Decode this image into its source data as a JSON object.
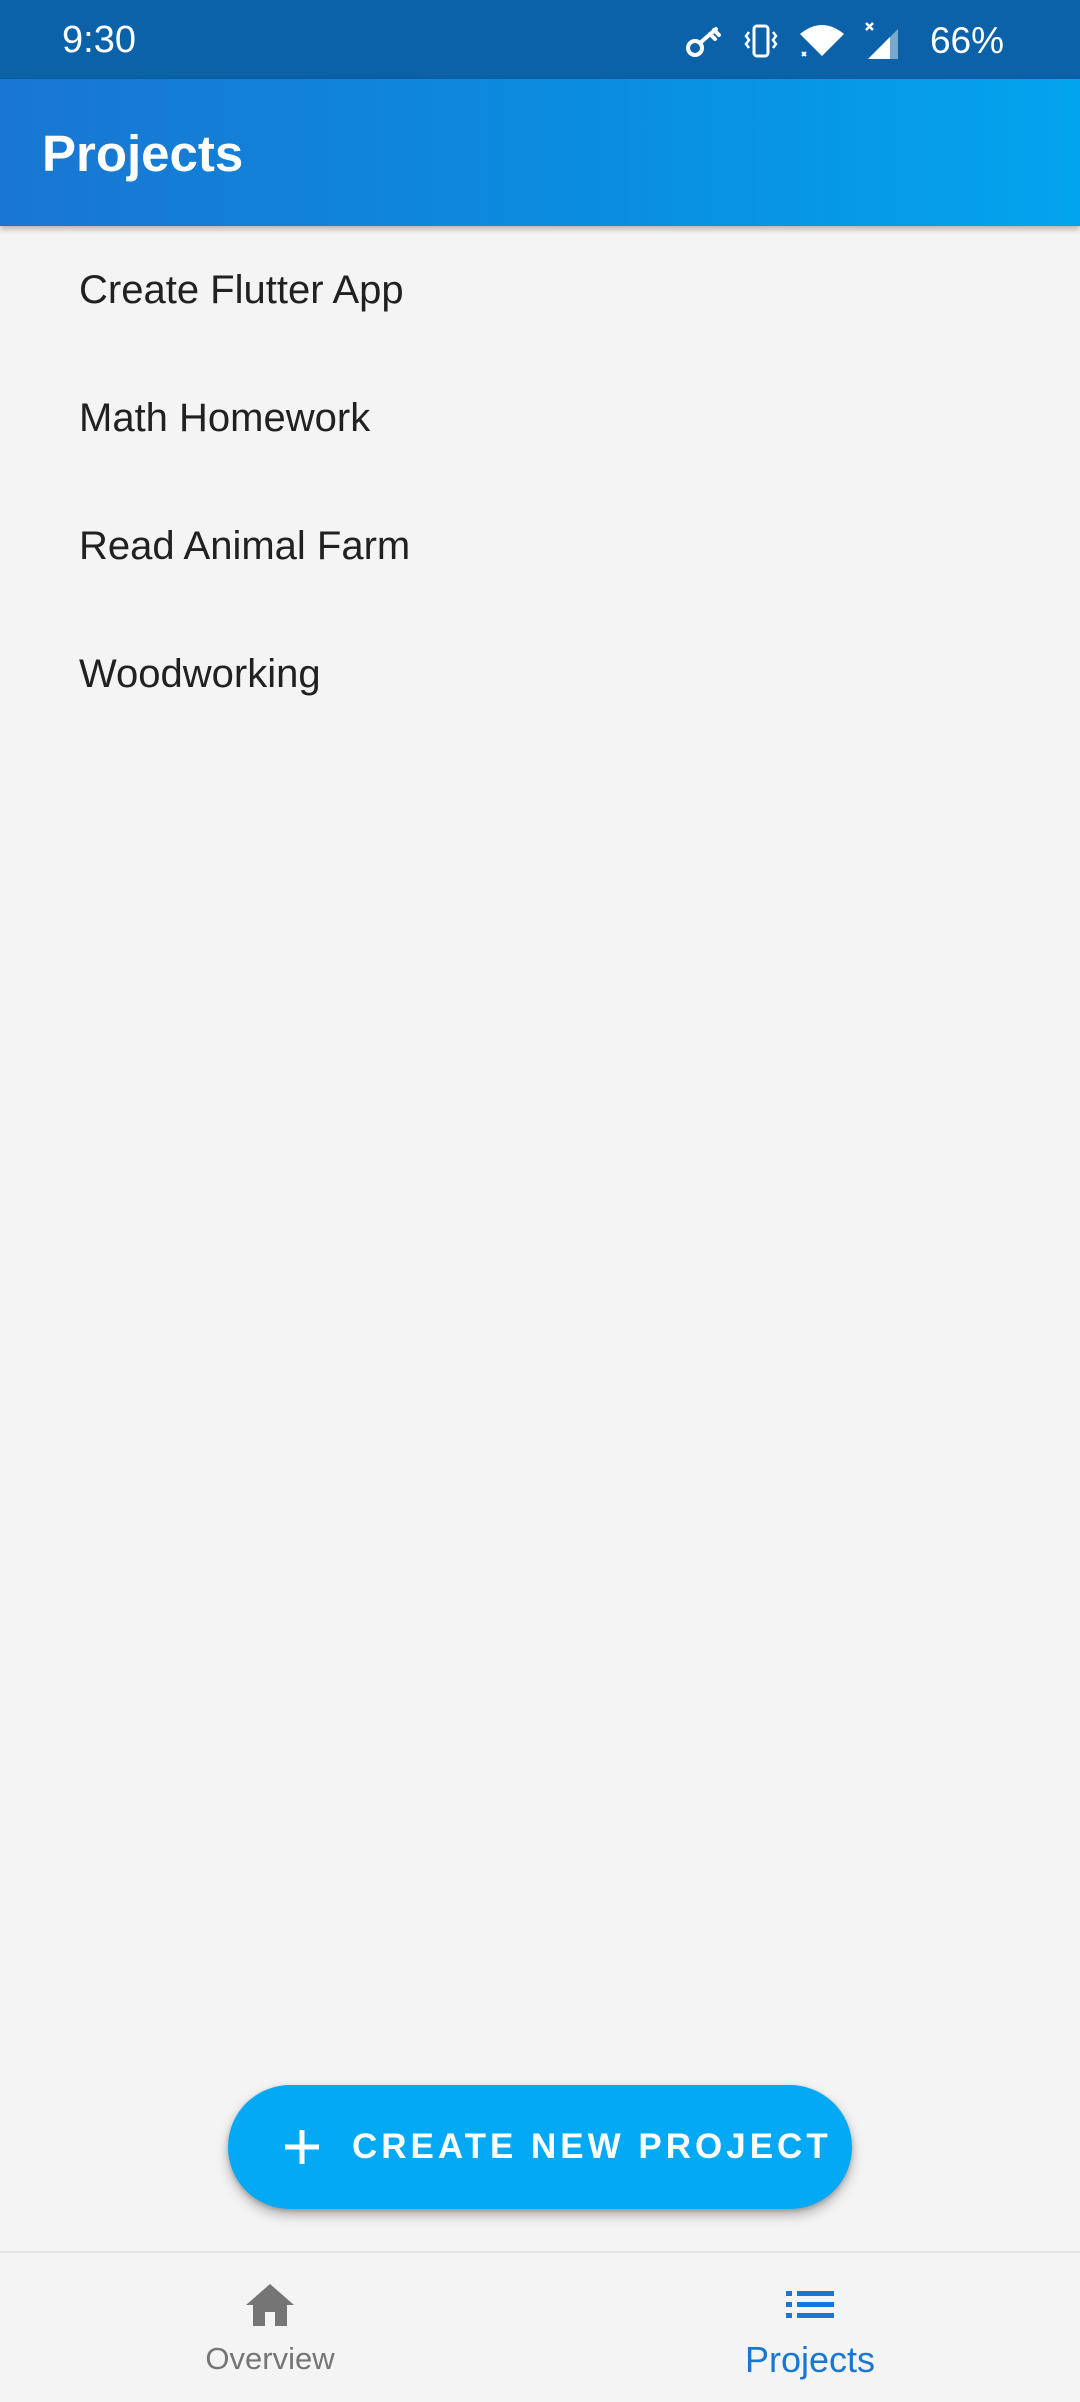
{
  "status_bar": {
    "time": "9:30",
    "battery": "66%",
    "icons": [
      "key-icon",
      "vibrate-icon",
      "wifi-icon",
      "signal-icon"
    ]
  },
  "app_bar": {
    "title": "Projects",
    "gradient_colors": [
      "#1976d2",
      "#03a4ef"
    ]
  },
  "projects": [
    {
      "name": "Create Flutter App"
    },
    {
      "name": "Math Homework"
    },
    {
      "name": "Read Animal Farm"
    },
    {
      "name": "Woodworking"
    }
  ],
  "fab": {
    "icon": "plus-icon",
    "label": "CREATE NEW PROJECT",
    "color": "#03a9f4"
  },
  "bottom_nav": {
    "items": [
      {
        "label": "Overview",
        "icon": "home-icon",
        "active": false
      },
      {
        "label": "Projects",
        "icon": "list-icon",
        "active": true
      }
    ],
    "active_color": "#1976d2",
    "inactive_color": "#757575"
  }
}
